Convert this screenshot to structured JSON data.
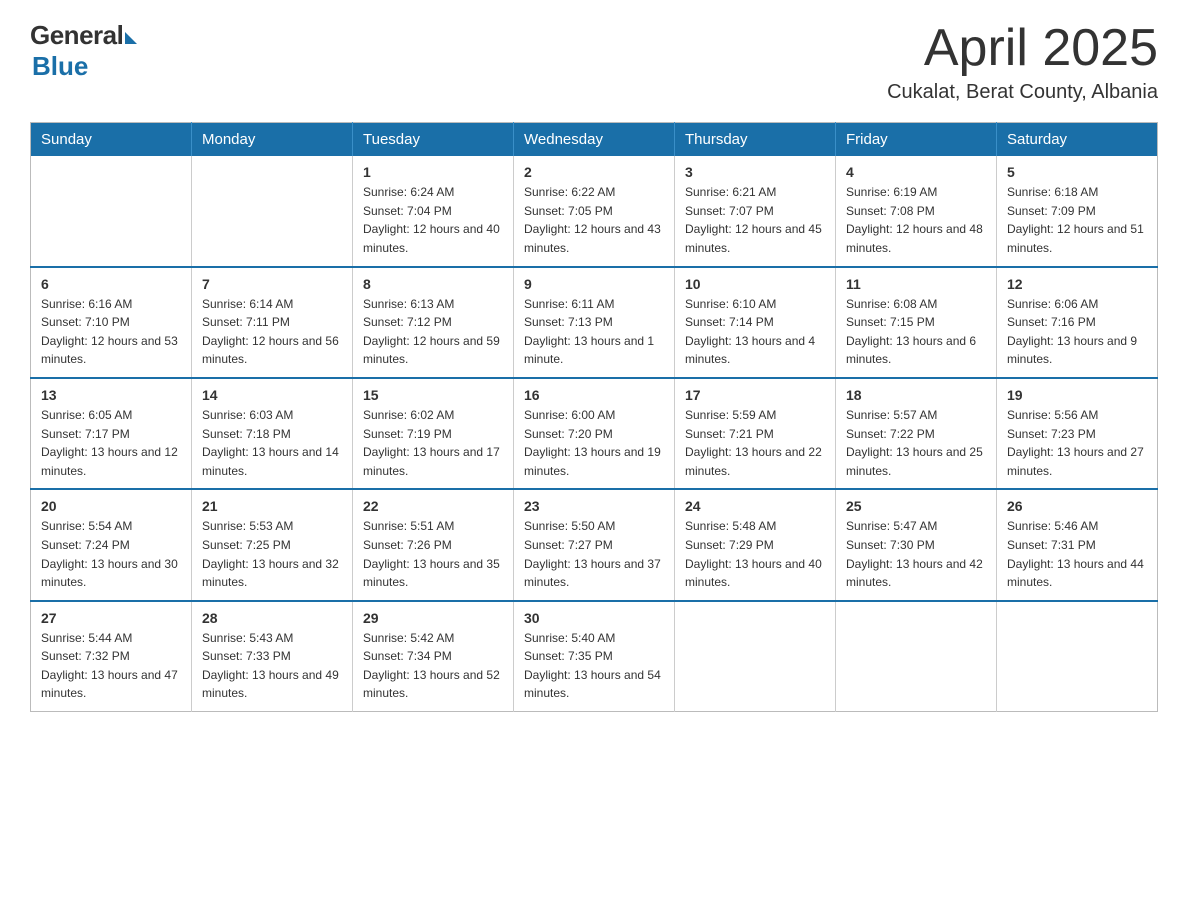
{
  "logo": {
    "general": "General",
    "blue": "Blue",
    "tagline": "Blue"
  },
  "title": "April 2025",
  "subtitle": "Cukalat, Berat County, Albania",
  "days_header": [
    "Sunday",
    "Monday",
    "Tuesday",
    "Wednesday",
    "Thursday",
    "Friday",
    "Saturday"
  ],
  "weeks": [
    [
      {
        "day": "",
        "sunrise": "",
        "sunset": "",
        "daylight": ""
      },
      {
        "day": "",
        "sunrise": "",
        "sunset": "",
        "daylight": ""
      },
      {
        "day": "1",
        "sunrise": "Sunrise: 6:24 AM",
        "sunset": "Sunset: 7:04 PM",
        "daylight": "Daylight: 12 hours and 40 minutes."
      },
      {
        "day": "2",
        "sunrise": "Sunrise: 6:22 AM",
        "sunset": "Sunset: 7:05 PM",
        "daylight": "Daylight: 12 hours and 43 minutes."
      },
      {
        "day": "3",
        "sunrise": "Sunrise: 6:21 AM",
        "sunset": "Sunset: 7:07 PM",
        "daylight": "Daylight: 12 hours and 45 minutes."
      },
      {
        "day": "4",
        "sunrise": "Sunrise: 6:19 AM",
        "sunset": "Sunset: 7:08 PM",
        "daylight": "Daylight: 12 hours and 48 minutes."
      },
      {
        "day": "5",
        "sunrise": "Sunrise: 6:18 AM",
        "sunset": "Sunset: 7:09 PM",
        "daylight": "Daylight: 12 hours and 51 minutes."
      }
    ],
    [
      {
        "day": "6",
        "sunrise": "Sunrise: 6:16 AM",
        "sunset": "Sunset: 7:10 PM",
        "daylight": "Daylight: 12 hours and 53 minutes."
      },
      {
        "day": "7",
        "sunrise": "Sunrise: 6:14 AM",
        "sunset": "Sunset: 7:11 PM",
        "daylight": "Daylight: 12 hours and 56 minutes."
      },
      {
        "day": "8",
        "sunrise": "Sunrise: 6:13 AM",
        "sunset": "Sunset: 7:12 PM",
        "daylight": "Daylight: 12 hours and 59 minutes."
      },
      {
        "day": "9",
        "sunrise": "Sunrise: 6:11 AM",
        "sunset": "Sunset: 7:13 PM",
        "daylight": "Daylight: 13 hours and 1 minute."
      },
      {
        "day": "10",
        "sunrise": "Sunrise: 6:10 AM",
        "sunset": "Sunset: 7:14 PM",
        "daylight": "Daylight: 13 hours and 4 minutes."
      },
      {
        "day": "11",
        "sunrise": "Sunrise: 6:08 AM",
        "sunset": "Sunset: 7:15 PM",
        "daylight": "Daylight: 13 hours and 6 minutes."
      },
      {
        "day": "12",
        "sunrise": "Sunrise: 6:06 AM",
        "sunset": "Sunset: 7:16 PM",
        "daylight": "Daylight: 13 hours and 9 minutes."
      }
    ],
    [
      {
        "day": "13",
        "sunrise": "Sunrise: 6:05 AM",
        "sunset": "Sunset: 7:17 PM",
        "daylight": "Daylight: 13 hours and 12 minutes."
      },
      {
        "day": "14",
        "sunrise": "Sunrise: 6:03 AM",
        "sunset": "Sunset: 7:18 PM",
        "daylight": "Daylight: 13 hours and 14 minutes."
      },
      {
        "day": "15",
        "sunrise": "Sunrise: 6:02 AM",
        "sunset": "Sunset: 7:19 PM",
        "daylight": "Daylight: 13 hours and 17 minutes."
      },
      {
        "day": "16",
        "sunrise": "Sunrise: 6:00 AM",
        "sunset": "Sunset: 7:20 PM",
        "daylight": "Daylight: 13 hours and 19 minutes."
      },
      {
        "day": "17",
        "sunrise": "Sunrise: 5:59 AM",
        "sunset": "Sunset: 7:21 PM",
        "daylight": "Daylight: 13 hours and 22 minutes."
      },
      {
        "day": "18",
        "sunrise": "Sunrise: 5:57 AM",
        "sunset": "Sunset: 7:22 PM",
        "daylight": "Daylight: 13 hours and 25 minutes."
      },
      {
        "day": "19",
        "sunrise": "Sunrise: 5:56 AM",
        "sunset": "Sunset: 7:23 PM",
        "daylight": "Daylight: 13 hours and 27 minutes."
      }
    ],
    [
      {
        "day": "20",
        "sunrise": "Sunrise: 5:54 AM",
        "sunset": "Sunset: 7:24 PM",
        "daylight": "Daylight: 13 hours and 30 minutes."
      },
      {
        "day": "21",
        "sunrise": "Sunrise: 5:53 AM",
        "sunset": "Sunset: 7:25 PM",
        "daylight": "Daylight: 13 hours and 32 minutes."
      },
      {
        "day": "22",
        "sunrise": "Sunrise: 5:51 AM",
        "sunset": "Sunset: 7:26 PM",
        "daylight": "Daylight: 13 hours and 35 minutes."
      },
      {
        "day": "23",
        "sunrise": "Sunrise: 5:50 AM",
        "sunset": "Sunset: 7:27 PM",
        "daylight": "Daylight: 13 hours and 37 minutes."
      },
      {
        "day": "24",
        "sunrise": "Sunrise: 5:48 AM",
        "sunset": "Sunset: 7:29 PM",
        "daylight": "Daylight: 13 hours and 40 minutes."
      },
      {
        "day": "25",
        "sunrise": "Sunrise: 5:47 AM",
        "sunset": "Sunset: 7:30 PM",
        "daylight": "Daylight: 13 hours and 42 minutes."
      },
      {
        "day": "26",
        "sunrise": "Sunrise: 5:46 AM",
        "sunset": "Sunset: 7:31 PM",
        "daylight": "Daylight: 13 hours and 44 minutes."
      }
    ],
    [
      {
        "day": "27",
        "sunrise": "Sunrise: 5:44 AM",
        "sunset": "Sunset: 7:32 PM",
        "daylight": "Daylight: 13 hours and 47 minutes."
      },
      {
        "day": "28",
        "sunrise": "Sunrise: 5:43 AM",
        "sunset": "Sunset: 7:33 PM",
        "daylight": "Daylight: 13 hours and 49 minutes."
      },
      {
        "day": "29",
        "sunrise": "Sunrise: 5:42 AM",
        "sunset": "Sunset: 7:34 PM",
        "daylight": "Daylight: 13 hours and 52 minutes."
      },
      {
        "day": "30",
        "sunrise": "Sunrise: 5:40 AM",
        "sunset": "Sunset: 7:35 PM",
        "daylight": "Daylight: 13 hours and 54 minutes."
      },
      {
        "day": "",
        "sunrise": "",
        "sunset": "",
        "daylight": ""
      },
      {
        "day": "",
        "sunrise": "",
        "sunset": "",
        "daylight": ""
      },
      {
        "day": "",
        "sunrise": "",
        "sunset": "",
        "daylight": ""
      }
    ]
  ]
}
